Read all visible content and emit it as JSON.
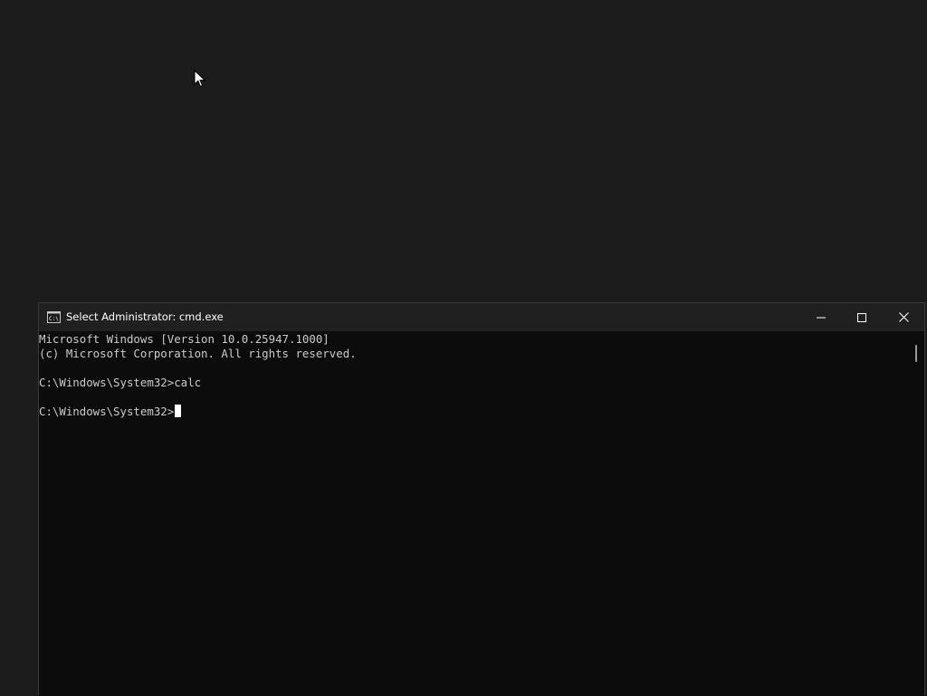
{
  "window": {
    "title": "Select Administrator: cmd.exe",
    "icon": "cmd-icon"
  },
  "caption_buttons": {
    "minimize": "minimize-icon",
    "maximize": "maximize-icon",
    "close": "close-icon"
  },
  "console": {
    "lines": [
      "Microsoft Windows [Version 10.0.25947.1000]",
      "(c) Microsoft Corporation. All rights reserved.",
      "",
      "C:\\Windows\\System32>calc",
      "",
      "C:\\Windows\\System32>"
    ],
    "text_color": "#cccccc",
    "background_color": "#0c0c0c"
  },
  "colors": {
    "desktop": "#1c1c1c",
    "titlebar": "#202020",
    "title_text": "#ffffff"
  }
}
